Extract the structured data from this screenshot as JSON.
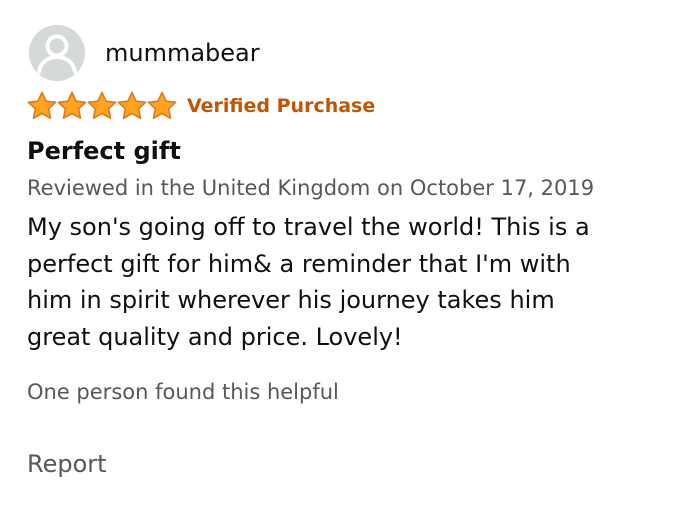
{
  "review": {
    "reviewer": {
      "name": "mummabear",
      "avatar_icon": "default-user-avatar-icon"
    },
    "rating": {
      "stars_filled": 5,
      "stars_total": 5,
      "star_color": "#ffa41c"
    },
    "badge": {
      "label": "Verified Purchase",
      "color": "#c45500"
    },
    "title": "Perfect gift",
    "meta": "Reviewed in the United Kingdom on October 17, 2019",
    "body_lines": [
      "My son's going off to travel the world! This is a",
      "perfect gift for him& a reminder that I'm with",
      "him in spirit wherever his journey takes him",
      "great quality and price. Lovely!"
    ],
    "helpful": "One person found this helpful",
    "report_label": "Report"
  }
}
